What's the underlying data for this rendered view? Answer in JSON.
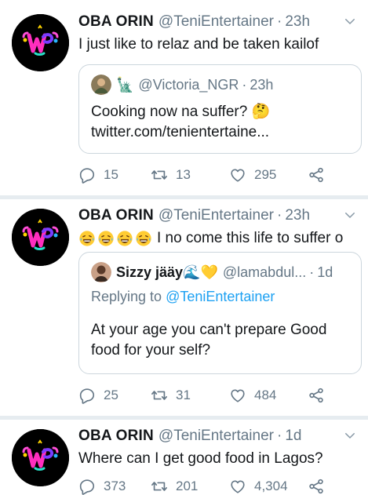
{
  "colors": {
    "name": "#14171a",
    "meta": "#657786",
    "link": "#1da1f2",
    "border": "#ccd6dd",
    "divider": "#e6ecf0"
  },
  "tweets": [
    {
      "name": "OBA ORIN",
      "handle": "@TeniEntertainer",
      "dot": "·",
      "time": "23h",
      "text": "I just like to relaz and be taken kailof",
      "quote": {
        "emoji": "🗽",
        "handle": "@Victoria_NGR",
        "dot": "·",
        "time": "23h",
        "line1": "Cooking now na suffer? 🤔",
        "line2": "twitter.com/tenientertaine..."
      },
      "replies": "15",
      "retweets": "13",
      "likes": "295"
    },
    {
      "name": "OBA ORIN",
      "handle": "@TeniEntertainer",
      "dot": "·",
      "time": "23h",
      "emojis": "😂😂😂😂",
      "text": "I no come this life to suffer o",
      "quote": {
        "name": "Sizzy jääy🌊💛",
        "handle": "@lamabdul...",
        "dot": "·",
        "time": "1d",
        "replying_prefix": "Replying to",
        "replying_to": "@TeniEntertainer",
        "line1": "At your age you can't prepare Good",
        "line2": "food for your self?"
      },
      "replies": "25",
      "retweets": "31",
      "likes": "484"
    },
    {
      "name": "OBA ORIN",
      "handle": "@TeniEntertainer",
      "dot": "·",
      "time": "1d",
      "text": "Where can I get good food in Lagos?",
      "replies": "373",
      "retweets": "201",
      "likes": "4,304"
    }
  ]
}
